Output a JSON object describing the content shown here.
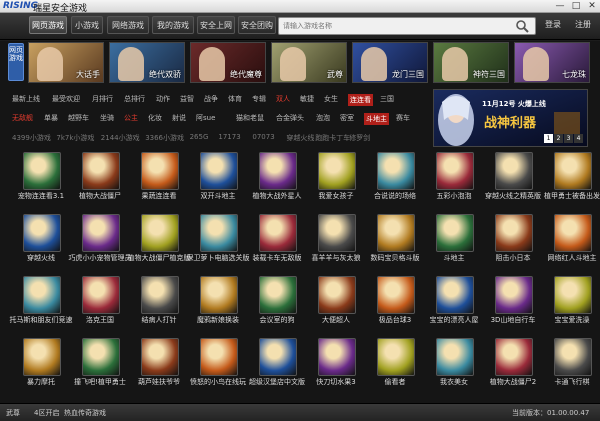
{
  "window": {
    "logo": "RISING",
    "title": "瑞星安全游戏"
  },
  "nav": {
    "tabs": [
      "网页游戏",
      "小游戏",
      "网络游戏",
      "我的游戏",
      "安全上网",
      "安全团购"
    ],
    "search_placeholder": "请输入游戏名称",
    "login": "登录",
    "register": "注册"
  },
  "side_tab": "网页游戏",
  "featured": [
    "大话手",
    "绝代双骄",
    "绝代魔尊",
    "武尊",
    "龙门三国",
    "神符三国",
    "七龙珠"
  ],
  "categories_row1": [
    "最新上线",
    "最受欢迎",
    "月排行",
    "总排行",
    "动作",
    "益智",
    "战争",
    "体育",
    "专辑",
    "双人",
    "敏捷",
    "女生",
    "连连看",
    "三国"
  ],
  "categories_row2": [
    "无敌舰",
    "单暴",
    "越野车",
    "坐骑",
    "公主",
    "化妆",
    "射说",
    "阿sue",
    "猫和老鼠",
    "合金弹头",
    "泡泡",
    "密室",
    "斗地主",
    "赛车"
  ],
  "subnav": [
    "4399小游戏",
    "7k7k小游戏",
    "2144小游戏",
    "3366小游戏",
    "265G",
    "17173",
    "07073",
    "穿越火线",
    "跑跑卡丁车",
    "修罗剑"
  ],
  "banner": {
    "date_text": "11月12号 火爆上线",
    "title": "战神利器",
    "pages": [
      "1",
      "2",
      "3",
      "4"
    ]
  },
  "games": [
    [
      "宠物连连看3.1",
      "植物大战僵尸",
      "果蔬连连看",
      "双开斗地主",
      "植物大战外星人",
      "我爱女孩子",
      "合说说的场络",
      "五彩小泡泡",
      "穿越火线之精英版",
      "植甲勇士被备出发"
    ],
    [
      "穿越火线",
      "巧虎小小宠物管理员",
      "植物大战僵尸植克版",
      "保卫萝卜电脑选关版",
      "装载卡车无敌版",
      "喜羊羊与灰太狼",
      "数码宝贝格斗版",
      "斗地主",
      "阻击小日本",
      "网络红人斗地主"
    ],
    [
      "托马斯和朋友们竞速",
      "洛克王国",
      "结病人打针",
      "魔鸦新娘换装",
      "会议室的狗",
      "大便超人",
      "极品台球3",
      "宝宝的漂亮人屋",
      "3D山地自行车",
      "宝宝爱洗澡"
    ],
    [
      "暴力摩托",
      "撞飞吧!植甲勇士",
      "葫芦娃扶爷爷",
      "愤怒的小鸟在线玩",
      "超级汉堡店中文版",
      "快刀切水果3",
      "偷看者",
      "我衣美女",
      "植物大战僵尸2",
      "卡通飞行棋"
    ]
  ],
  "status": {
    "left": [
      "武尊",
      "4区开启",
      "热血传奇游戏"
    ],
    "version": "当前版本：01.00.00.47"
  },
  "colors": {
    "accent": "#b0201a",
    "hot": "#e23b2e",
    "side": "#2f5ea8"
  }
}
